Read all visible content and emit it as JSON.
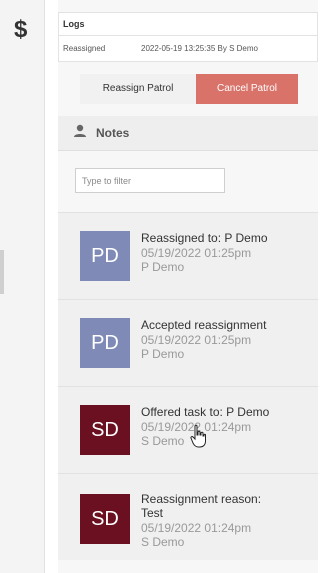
{
  "sidebar": {
    "icon_name": "dollar-icon",
    "icon_glyph": "$"
  },
  "logs": {
    "title": "Logs",
    "row": {
      "action": "Reassigned",
      "detail": "2022-05-19 13:25:35 By S Demo"
    }
  },
  "actions": {
    "reassign_label": "Reassign Patrol",
    "cancel_label": "Cancel Patrol"
  },
  "notes": {
    "title": "Notes",
    "filter_placeholder": "Type to filter",
    "items": [
      {
        "initials": "PD",
        "avatar_color": "#7f8bb6",
        "lines": [
          "Reassigned to: P Demo"
        ],
        "date": "05/19/2022 01:25pm",
        "author": "P Demo"
      },
      {
        "initials": "PD",
        "avatar_color": "#7f8bb6",
        "lines": [
          "Accepted reassignment"
        ],
        "date": "05/19/2022 01:25pm",
        "author": "P Demo"
      },
      {
        "initials": "SD",
        "avatar_color": "#6b1020",
        "lines": [
          "Offered task to: P Demo"
        ],
        "date": "05/19/2022 01:24pm",
        "author": "S Demo"
      },
      {
        "initials": "SD",
        "avatar_color": "#6b1020",
        "lines": [
          "Reassignment reason:",
          "Test"
        ],
        "date": "05/19/2022 01:24pm",
        "author": "S Demo"
      }
    ]
  },
  "colors": {
    "cancel_button": "#d9736a",
    "reassign_button": "#f1f1f1",
    "panel_bg": "#f7f7f7"
  }
}
